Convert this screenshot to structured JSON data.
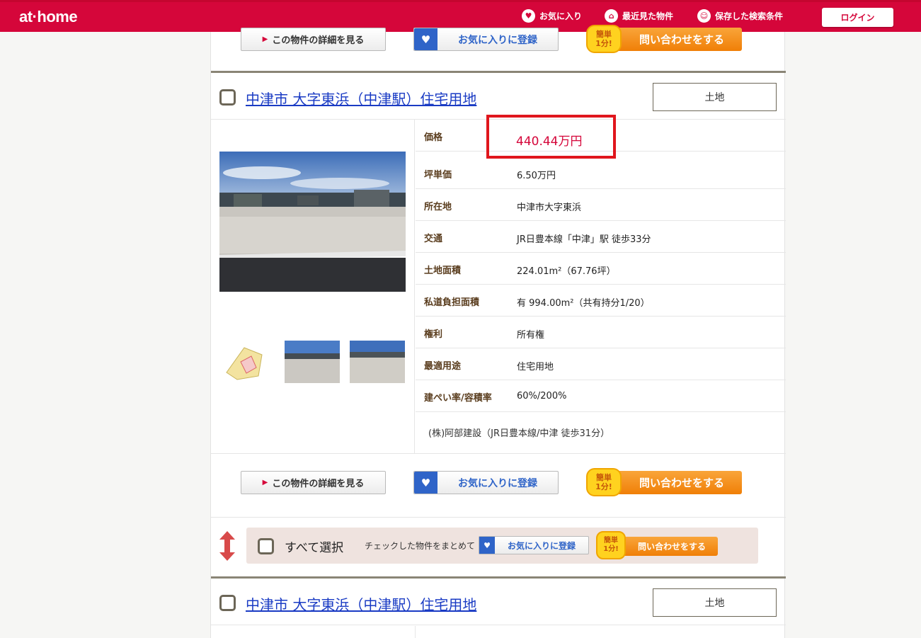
{
  "header": {
    "logo": "at·home",
    "nav": [
      {
        "label": "お気に入り",
        "icon": "heart-icon"
      },
      {
        "label": "最近見た物件",
        "icon": "house-icon"
      },
      {
        "label": "保存した検索条件",
        "icon": "saved-search-icon"
      }
    ],
    "login_label": "ログイン"
  },
  "actions": {
    "detail_label": "この物件の詳細を見る",
    "favorite_label": "お気に入りに登録",
    "inquiry_label": "問い合わせをする",
    "inquiry_badge_line1": "簡単",
    "inquiry_badge_line2": "1分!"
  },
  "listing": {
    "title": "中津市 大字東浜（中津駅）住宅用地",
    "type": "土地",
    "price": "440.44万円",
    "rows": [
      {
        "key": "価格",
        "value": ""
      },
      {
        "key": "坪単価",
        "value": "6.50万円"
      },
      {
        "key": "所在地",
        "value": "中津市大字東浜"
      },
      {
        "key": "交通",
        "value": "JR日豊本線「中津」駅 徒歩33分"
      },
      {
        "key": "土地面積",
        "value": "224.01m²（67.76坪）"
      },
      {
        "key": "私道負担面積",
        "value": "有  994.00m²（共有持分1/20）"
      },
      {
        "key": "権利",
        "value": "所有権"
      },
      {
        "key": "最適用途",
        "value": "住宅用地"
      },
      {
        "key": "建ぺい率/容積率",
        "value": "60%/200%"
      }
    ],
    "agent_note": "(株)阿部建設（JR日豊本線/中津 徒歩31分）"
  },
  "select_bar": {
    "select_all_label": "すべて選択",
    "note": "チェックした物件をまとめて",
    "favorite_label": "お気に入りに登録",
    "inquiry_label": "問い合わせをする",
    "badge_line1": "簡単",
    "badge_line2": "1分!"
  },
  "next_listing": {
    "title": "中津市 大字東浜（中津駅）住宅用地",
    "type": "土地"
  },
  "colors": {
    "brand": "#d5063a",
    "link": "#1a3bc4",
    "price": "#d5063a",
    "highlight_box": "#e0161d",
    "inquiry": "#f07f07"
  }
}
